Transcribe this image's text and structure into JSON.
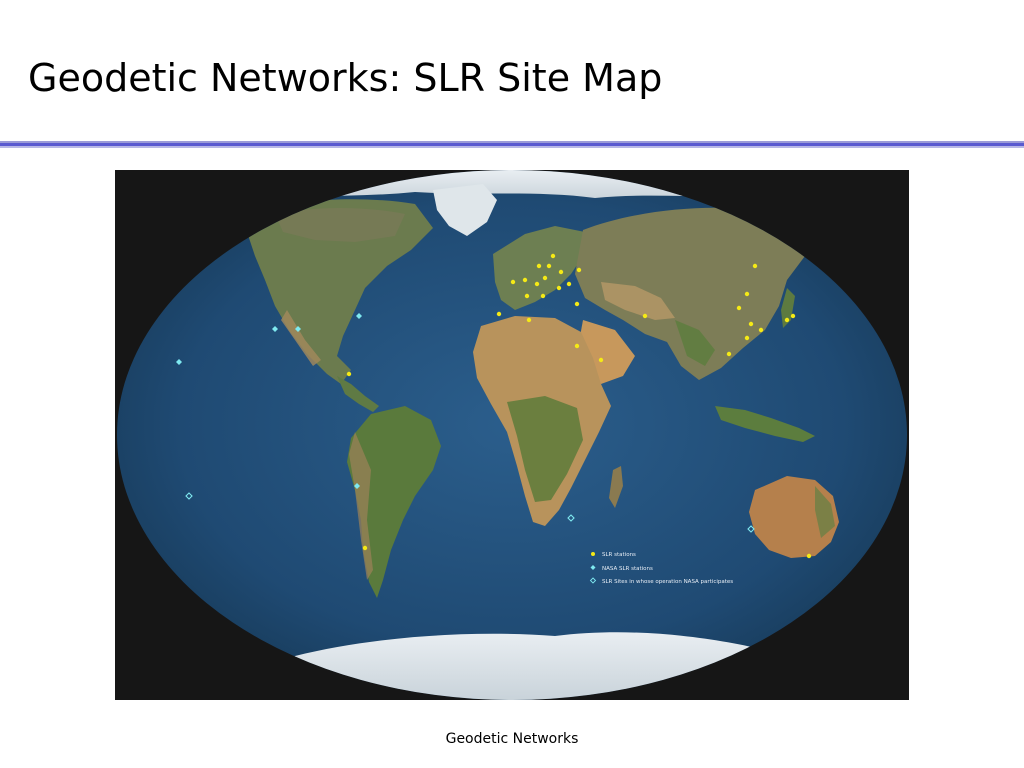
{
  "slide": {
    "title": "Geodetic Networks: SLR Site Map",
    "footer": "Geodetic Networks"
  },
  "colors": {
    "title_rule": "#5a5ad0",
    "slr_station": "#f5ea16",
    "nasa_station": "#7fe9f0",
    "nasa_participating": "#7fe9f0",
    "ocean": "#1f4a73",
    "map_background": "#161616"
  },
  "map": {
    "projection": "world-oval",
    "legend": {
      "items": [
        {
          "label": "SLR stations",
          "symbol": "yellow-dot-icon"
        },
        {
          "label": "NASA SLR stations",
          "symbol": "filled-diamond-icon"
        },
        {
          "label": "SLR Sites in whose operation NASA participates",
          "symbol": "hollow-diamond-icon"
        }
      ]
    }
  }
}
